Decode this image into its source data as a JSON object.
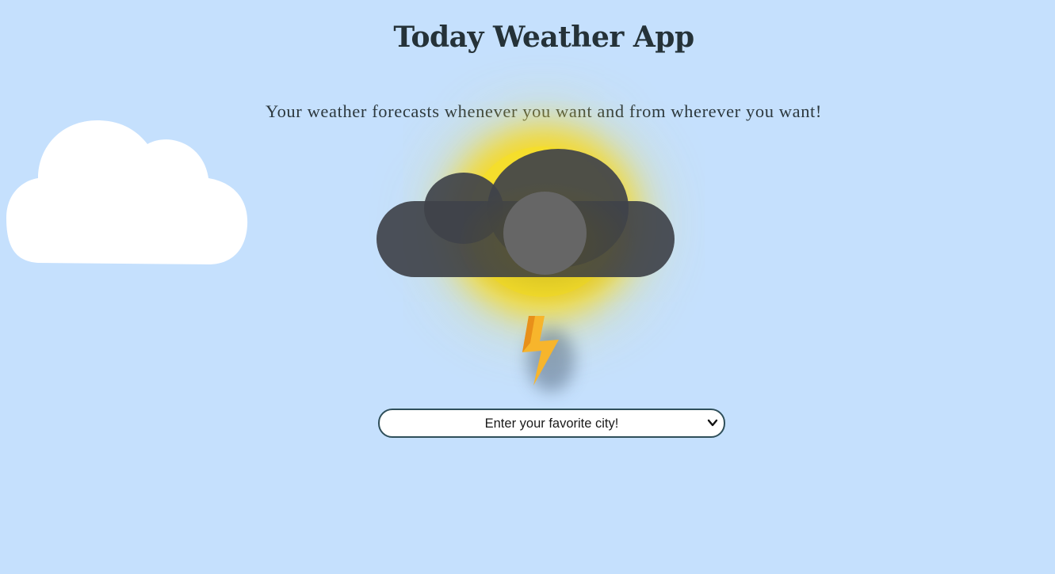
{
  "page": {
    "title": "Today Weather App",
    "subtitle": "Your weather forecasts whenever you want and from wherever you want!"
  },
  "weather_icon": {
    "icon_name": "thunderstorm-sun-icon",
    "cloud_color": "#3f424a",
    "sun_color": "#f5de2c",
    "bolt_color": "#f5a623"
  },
  "background_cloud": {
    "icon_name": "cloud-icon",
    "color": "#ffffff"
  },
  "city_select": {
    "selected": "Enter your favorite city!",
    "options": [
      "Enter your favorite city!"
    ],
    "chevron_icon": "chevron-down-icon"
  },
  "colors": {
    "background": "#c5e0fd",
    "title_text": "#253238",
    "select_border": "#2f4f5a"
  }
}
